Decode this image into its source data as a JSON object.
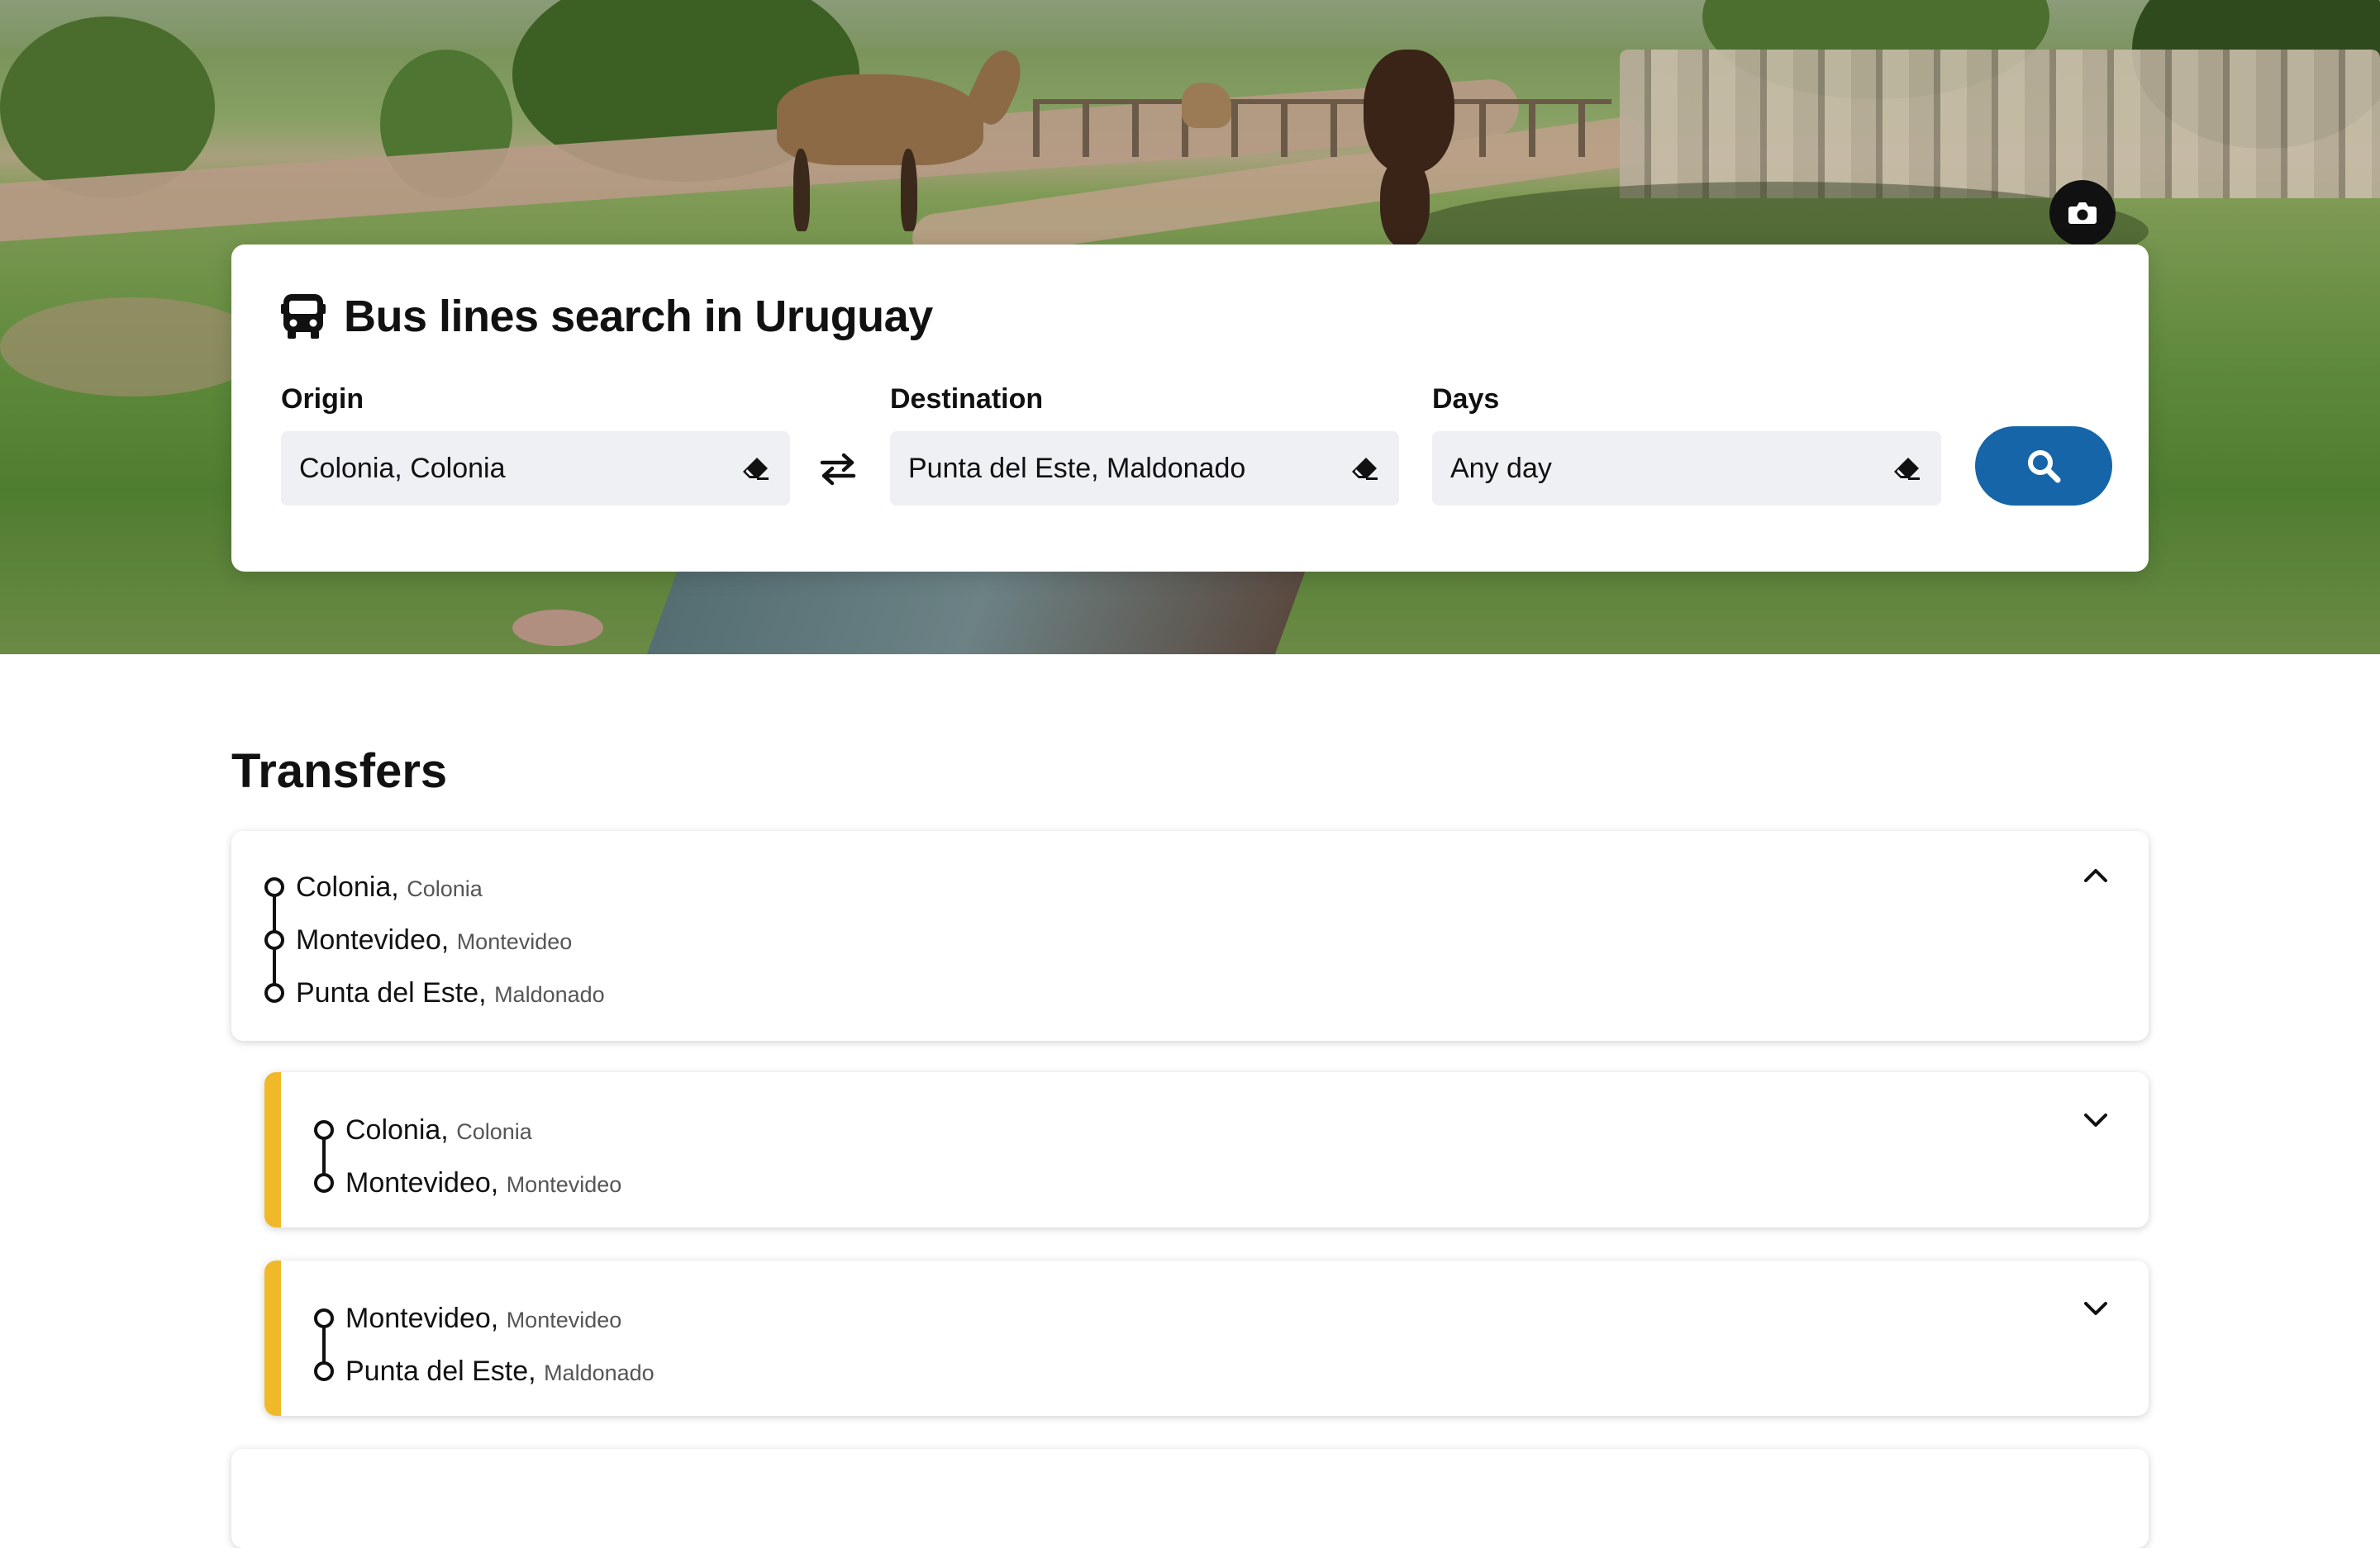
{
  "search": {
    "title": "Bus lines search in Uruguay",
    "origin_label": "Origin",
    "origin_value": "Colonia, Colonia",
    "destination_label": "Destination",
    "destination_value": "Punta del Este, Maldonado",
    "days_label": "Days",
    "days_value": "Any day"
  },
  "transfers": {
    "title": "Transfers",
    "routes": [
      {
        "stops": [
          {
            "city": "Colonia,",
            "region": "Colonia"
          },
          {
            "city": "Montevideo,",
            "region": "Montevideo"
          },
          {
            "city": "Punta del Este,",
            "region": "Maldonado"
          }
        ],
        "expanded": true
      },
      {
        "stops": [
          {
            "city": "Colonia,",
            "region": "Colonia"
          },
          {
            "city": "Montevideo,",
            "region": "Montevideo"
          }
        ],
        "expanded": false
      },
      {
        "stops": [
          {
            "city": "Montevideo,",
            "region": "Montevideo"
          },
          {
            "city": "Punta del Este,",
            "region": "Maldonado"
          }
        ],
        "expanded": false
      }
    ]
  },
  "colors": {
    "search_button": "#1565a8",
    "leg_accent": "#f0b92a"
  },
  "icons": [
    "bus-icon",
    "camera-icon",
    "eraser-icon",
    "swap-arrows-icon",
    "search-icon",
    "chevron-up-icon",
    "chevron-down-icon"
  ]
}
